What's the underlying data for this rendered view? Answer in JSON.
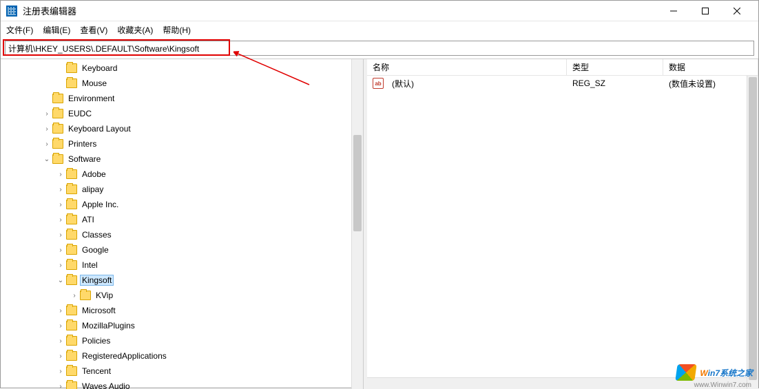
{
  "window": {
    "title": "注册表编辑器"
  },
  "menu": {
    "file": "文件(F)",
    "edit": "编辑(E)",
    "view": "查看(V)",
    "favorites": "收藏夹(A)",
    "help": "帮助(H)"
  },
  "address": {
    "path": "计算机\\HKEY_USERS\\.DEFAULT\\Software\\Kingsoft"
  },
  "tree": [
    {
      "indent": 4,
      "expander": "",
      "label": "Keyboard"
    },
    {
      "indent": 4,
      "expander": "",
      "label": "Mouse"
    },
    {
      "indent": 3,
      "expander": "",
      "label": "Environment"
    },
    {
      "indent": 3,
      "expander": ">",
      "label": "EUDC"
    },
    {
      "indent": 3,
      "expander": ">",
      "label": "Keyboard Layout"
    },
    {
      "indent": 3,
      "expander": ">",
      "label": "Printers"
    },
    {
      "indent": 3,
      "expander": "v",
      "label": "Software"
    },
    {
      "indent": 4,
      "expander": ">",
      "label": "Adobe"
    },
    {
      "indent": 4,
      "expander": ">",
      "label": "alipay"
    },
    {
      "indent": 4,
      "expander": ">",
      "label": "Apple Inc."
    },
    {
      "indent": 4,
      "expander": ">",
      "label": "ATI"
    },
    {
      "indent": 4,
      "expander": ">",
      "label": "Classes"
    },
    {
      "indent": 4,
      "expander": ">",
      "label": "Google"
    },
    {
      "indent": 4,
      "expander": ">",
      "label": "Intel"
    },
    {
      "indent": 4,
      "expander": "v",
      "label": "Kingsoft",
      "selected": true
    },
    {
      "indent": 5,
      "expander": ">",
      "label": "KVip"
    },
    {
      "indent": 4,
      "expander": ">",
      "label": "Microsoft"
    },
    {
      "indent": 4,
      "expander": ">",
      "label": "MozillaPlugins"
    },
    {
      "indent": 4,
      "expander": ">",
      "label": "Policies"
    },
    {
      "indent": 4,
      "expander": ">",
      "label": "RegisteredApplications"
    },
    {
      "indent": 4,
      "expander": ">",
      "label": "Tencent"
    },
    {
      "indent": 4,
      "expander": ">",
      "label": "Waves Audio"
    }
  ],
  "list": {
    "columns": {
      "name": "名称",
      "type": "类型",
      "data": "数据"
    },
    "rows": [
      {
        "name": "(默认)",
        "type": "REG_SZ",
        "data": "(数值未设置)"
      }
    ]
  },
  "watermark": {
    "brand_html": "Win7系统之家",
    "url": "www.Winwin7.com"
  }
}
